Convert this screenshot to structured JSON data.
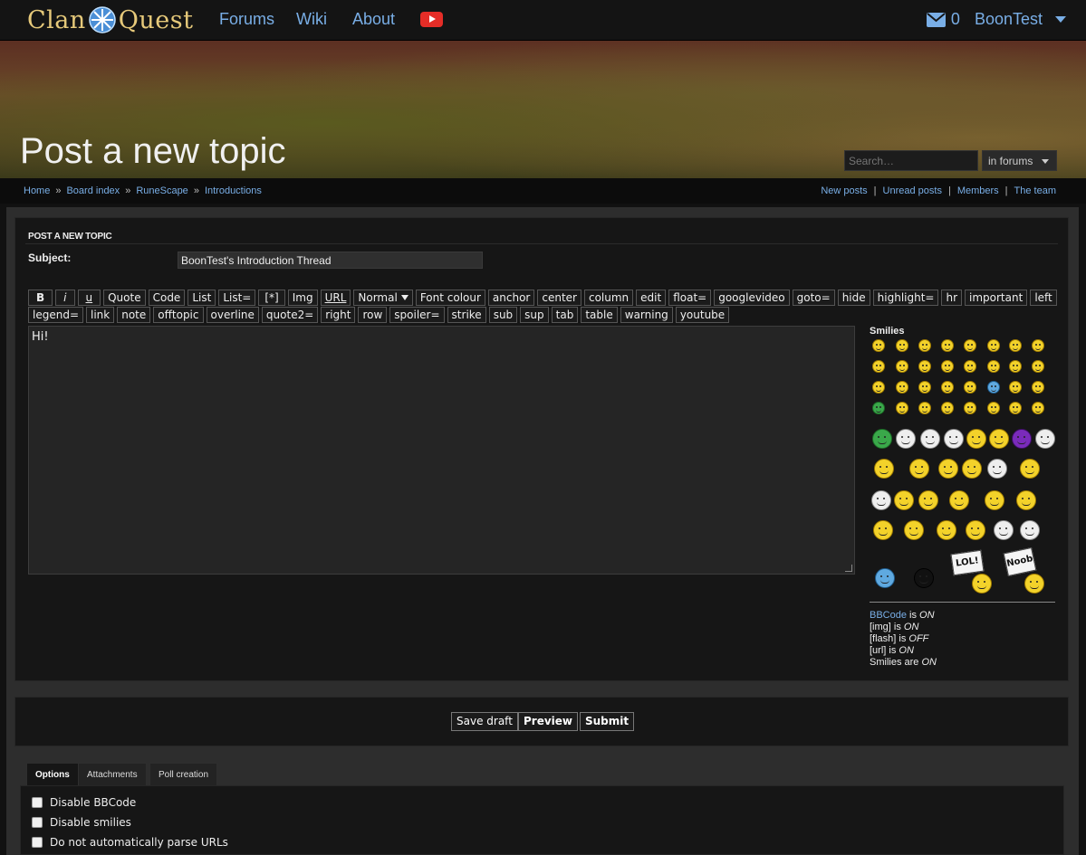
{
  "header": {
    "logo_text_left": "Clan",
    "logo_text_right": "Quest",
    "nav": [
      "Forums",
      "Wiki",
      "About"
    ],
    "youtube_icon": "youtube-icon",
    "message_count": "0",
    "username": "BoonTest"
  },
  "banner": {
    "title": "Post a new topic",
    "search_placeholder": "Search…",
    "search_scope": "in forums"
  },
  "breadcrumb": {
    "items": [
      "Home",
      "Board index",
      "RuneScape",
      "Introductions"
    ],
    "separator": "»"
  },
  "quick_links": [
    "New posts",
    "Unread posts",
    "Members",
    "The team"
  ],
  "form": {
    "section_title": "POST A NEW TOPIC",
    "subject_label": "Subject:",
    "subject_value": "BoonTest's Introduction Thread",
    "bbcode_row1": [
      "B",
      "i",
      "u",
      "Quote",
      "Code",
      "List",
      "List=",
      "[*]",
      "Img",
      "URL",
      "Normal",
      "Font colour",
      "anchor",
      "center",
      "column",
      "edit",
      "float=",
      "googlevideo",
      "goto=",
      "hide",
      "highlight=",
      "hr",
      "important",
      "left"
    ],
    "bbcode_row2": [
      "legend=",
      "link",
      "note",
      "offtopic",
      "overline",
      "quote2=",
      "right",
      "row",
      "spoiler=",
      "strike",
      "sub",
      "sup",
      "tab",
      "table",
      "warning",
      "youtube"
    ],
    "message": "Hi!"
  },
  "smilies": {
    "title": "Smilies",
    "sign1": "LOL!",
    "sign2": "Noob"
  },
  "status": {
    "bbcode_link": "BBCode",
    "bbcode_is": " is ",
    "bbcode_state": "ON",
    "img_label": "[img] is ",
    "img_state": "ON",
    "flash_label": "[flash] is ",
    "flash_state": "OFF",
    "url_label": "[url] is ",
    "url_state": "ON",
    "smilies_label": "Smilies are ",
    "smilies_state": "ON"
  },
  "actions": {
    "save_draft": "Save draft",
    "preview": "Preview",
    "submit": "Submit"
  },
  "tabs": [
    "Options",
    "Attachments",
    "Poll creation"
  ],
  "options": [
    "Disable BBCode",
    "Disable smilies",
    "Do not automatically parse URLs"
  ],
  "colors": {
    "link": "#79aee6",
    "logo_gold": "#e6c97a",
    "youtube_red": "#e52d27"
  }
}
